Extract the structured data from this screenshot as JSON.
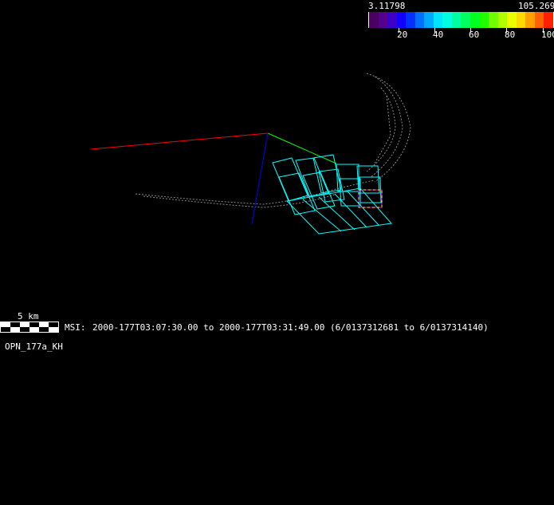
{
  "colorbar": {
    "min_label": "3.11798",
    "max_label": "105.269",
    "tick_labels": [
      "20",
      "40",
      "60",
      "80",
      "100"
    ],
    "colors": [
      "#4a0060",
      "#560090",
      "#3c00c8",
      "#1400ff",
      "#0032ff",
      "#0070ff",
      "#00a8ff",
      "#00e4ff",
      "#00ffe0",
      "#00ffa0",
      "#00ff60",
      "#00ff20",
      "#20ff00",
      "#70ff00",
      "#b0ff00",
      "#e8ff00",
      "#ffd800",
      "#ffa000",
      "#ff6000",
      "#ff2000"
    ]
  },
  "scale_bar": {
    "label": "5 km"
  },
  "info": {
    "instrument": "MSI:",
    "time_range": "2000-177T03:07:30.00 to 2000-177T03:31:49.00 (6/0137312681 to 6/0137314140)",
    "plan_name": "OPN_177a_KH"
  },
  "axes_colors": {
    "x": "#ff0000",
    "y": "#00ff00",
    "z": "#0000ff"
  },
  "footprint_color": "#00ffff",
  "selected_footprint_colors": [
    "#ffff00",
    "#ff00ff"
  ]
}
